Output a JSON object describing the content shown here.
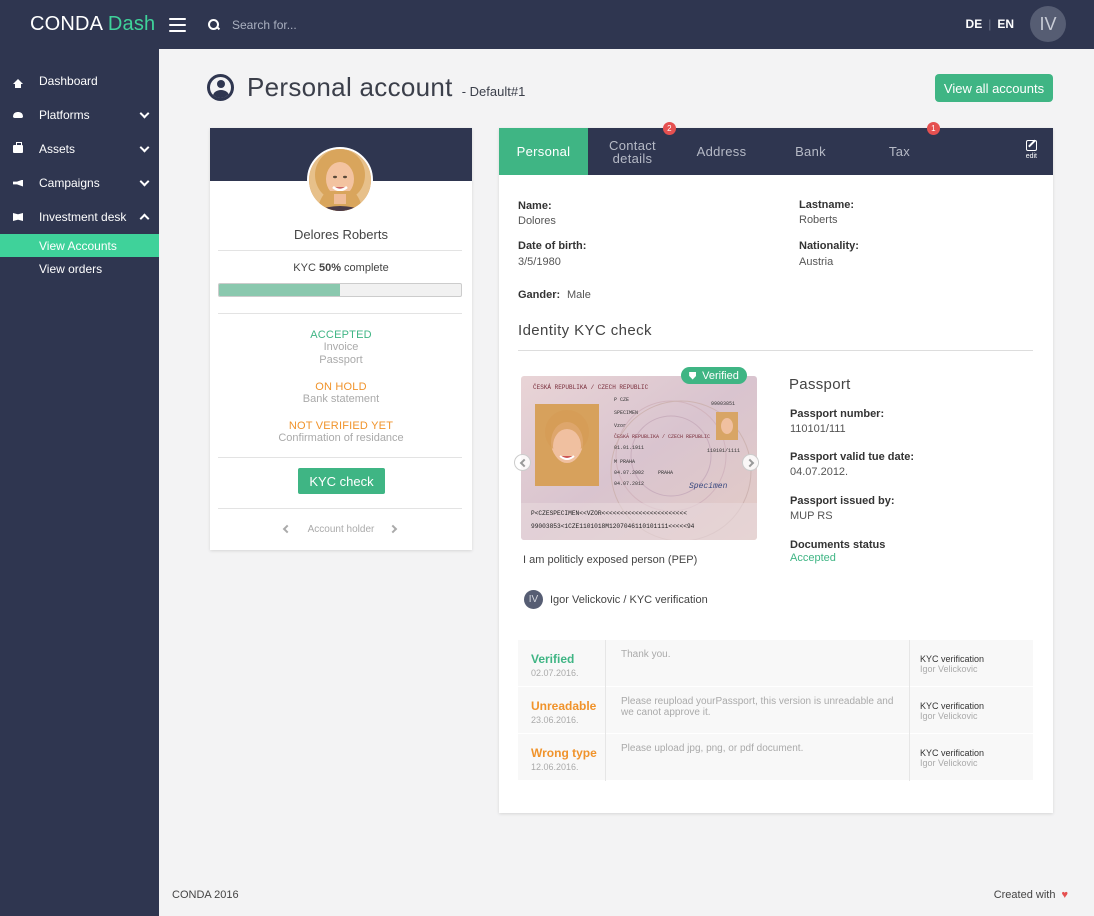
{
  "brand": {
    "name": "CONDA",
    "accent": "Dash"
  },
  "search": {
    "placeholder": "Search for..."
  },
  "lang": {
    "de": "DE",
    "en": "EN"
  },
  "user": {
    "initials": "IV"
  },
  "sidebar": {
    "items": [
      {
        "label": "Dashboard",
        "icon": "home-icon"
      },
      {
        "label": "Platforms",
        "icon": "cloud-icon"
      },
      {
        "label": "Assets",
        "icon": "briefcase-icon"
      },
      {
        "label": "Campaigns",
        "icon": "megaphone-icon"
      },
      {
        "label": "Investment desk",
        "icon": "book-icon"
      }
    ],
    "sub_items": [
      {
        "label": "View Accounts",
        "active": true
      },
      {
        "label": "View orders",
        "active": false
      }
    ]
  },
  "page": {
    "title": "Personal account",
    "subtitle": "- Default#1",
    "view_all_label": "View all accounts"
  },
  "profile": {
    "name": "Delores Roberts",
    "kyc_prefix": "KYC ",
    "kyc_percent": "50%",
    "kyc_suffix": " complete",
    "kyc_progress": 0.5,
    "statuses": [
      {
        "title": "ACCEPTED",
        "docs": [
          "Invoice",
          "Passport"
        ],
        "color": "green"
      },
      {
        "title": "ON HOLD",
        "docs": [
          "Bank statement"
        ],
        "color": "orange"
      },
      {
        "title": "NOT VERIFIED YET",
        "docs": [
          "Confirmation of residance"
        ],
        "color": "orange"
      }
    ],
    "kyc_button": "KYC check",
    "pager_label": "Account holder"
  },
  "tabs": [
    {
      "label": "Personal",
      "active": true,
      "badge": ""
    },
    {
      "label": "Contact details",
      "active": false,
      "badge": "2"
    },
    {
      "label": "Address",
      "active": false,
      "badge": ""
    },
    {
      "label": "Bank",
      "active": false,
      "badge": ""
    },
    {
      "label": "Tax",
      "active": false,
      "badge": "1"
    }
  ],
  "edit_label": "edit",
  "personal": {
    "name_label": "Name:",
    "name": "Dolores",
    "lastname_label": "Lastname:",
    "lastname": "Roberts",
    "dob_label": "Date of birth:",
    "dob": "3/5/1980",
    "nationality_label": "Nationality:",
    "nationality": "Austria",
    "gender_label": "Gander:",
    "gender": "Male"
  },
  "identity": {
    "title": "Identity KYC check",
    "verified_label": "Verified",
    "pep_text": "I am politicly exposed person (PEP)",
    "passport_title": "Passport",
    "number_label": "Passport number:",
    "number": "110101/111",
    "valid_label": "Passport valid tue date:",
    "valid": "04.07.2012.",
    "issued_label": "Passport issued by:",
    "issued": "MUP RS",
    "status_label": "Documents status",
    "status": "Accepted",
    "passport_text": {
      "header": "ČESKÁ REPUBLIKA / CZECH REPUBLIC",
      "type_line": "P   CZE",
      "number": "99003851",
      "surname": "SPECIMEN",
      "given": "Vzor",
      "republic": "ČESKÁ REPUBLIKA / CZECH REPUBLIC",
      "dob": "01.01.1911",
      "personal_no": "110101/1111",
      "sex_place": "M      PRAHA",
      "issue_date": "04.07.2002",
      "issue_place": "PRAHA",
      "expiry": "04.07.2012",
      "signature": "Specimen",
      "mrz1": "P<CZESPECIMEN<<VZOR<<<<<<<<<<<<<<<<<<<<<<<",
      "mrz2": "99003853<1CZE1101018M1207046110101111<<<<<94"
    }
  },
  "verifier": {
    "initials": "IV",
    "text": "Igor Velickovic / KYC verification"
  },
  "history": [
    {
      "status": "Verified",
      "date": "02.07.2016.",
      "message": "Thank you.",
      "type": "KYC verification",
      "by": "Igor Velickovic",
      "color": "green"
    },
    {
      "status": "Unreadable",
      "date": "23.06.2016.",
      "message": "Please reupload yourPassport, this version is unreadable and we canot approve it.",
      "type": "KYC verification",
      "by": "Igor Velickovic",
      "color": "orange"
    },
    {
      "status": "Wrong type",
      "date": "12.06.2016.",
      "message": "Please upload jpg, png, or pdf document.",
      "type": "KYC verification",
      "by": "Igor Velickovic",
      "color": "orange"
    }
  ],
  "footer": {
    "left": "CONDA 2016",
    "right": "Created with"
  },
  "colors": {
    "navy": "#2f3650",
    "green": "#3fb584",
    "mint": "#3fd29a",
    "orange": "#f0932b",
    "red": "#e55050"
  }
}
